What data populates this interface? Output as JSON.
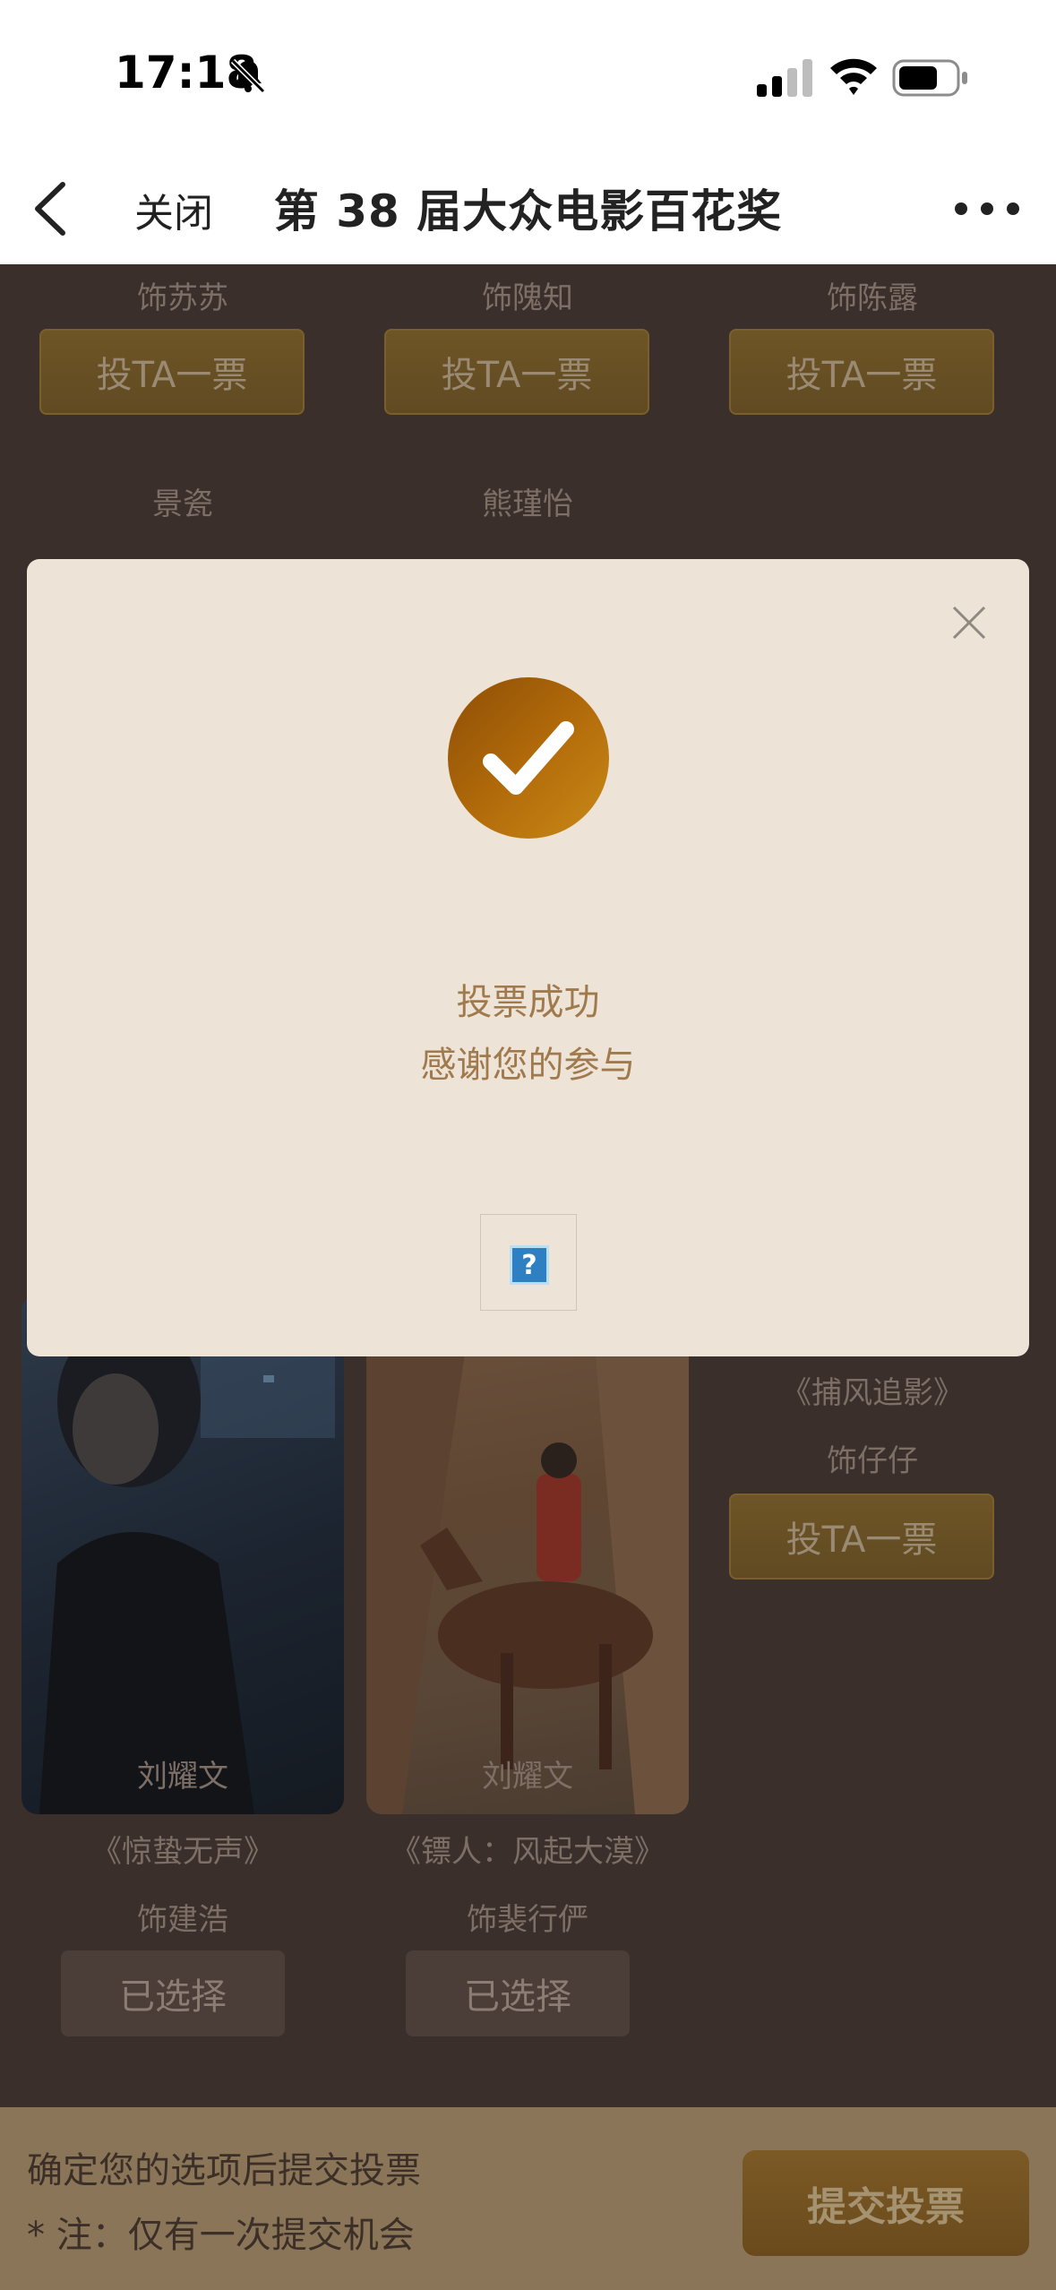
{
  "status_bar": {
    "time": "17:18"
  },
  "nav": {
    "close_label": "关闭",
    "title": "第 38 届大众电影百花奖"
  },
  "top_roles": [
    "饰苏苏",
    "饰隗知",
    "饰陈露"
  ],
  "vote_label": "投TA一票",
  "middle_names": [
    "景瓷",
    "熊瑾怡"
  ],
  "card3": {
    "film": "《捕风追影》",
    "role": "饰仔仔"
  },
  "cards": [
    {
      "name": "刘耀文",
      "film": "《惊蛰无声》",
      "role": "饰建浩",
      "status": "已选择"
    },
    {
      "name": "刘耀文",
      "film": "《镖人：风起大漠》",
      "role": "饰裴行俨",
      "status": "已选择"
    }
  ],
  "modal": {
    "title": "投票成功",
    "subtitle": "感谢您的参与"
  },
  "bottom": {
    "line1": "确定您的选项后提交投票",
    "line2": "* 注：仅有一次提交机会",
    "submit_label": "提交投票"
  },
  "colors": {
    "accent": "#b46d0b",
    "modal_bg": "#ede3d6",
    "overlay_bg": "#3a2f2b",
    "bottom_bar": "#8a7558"
  }
}
